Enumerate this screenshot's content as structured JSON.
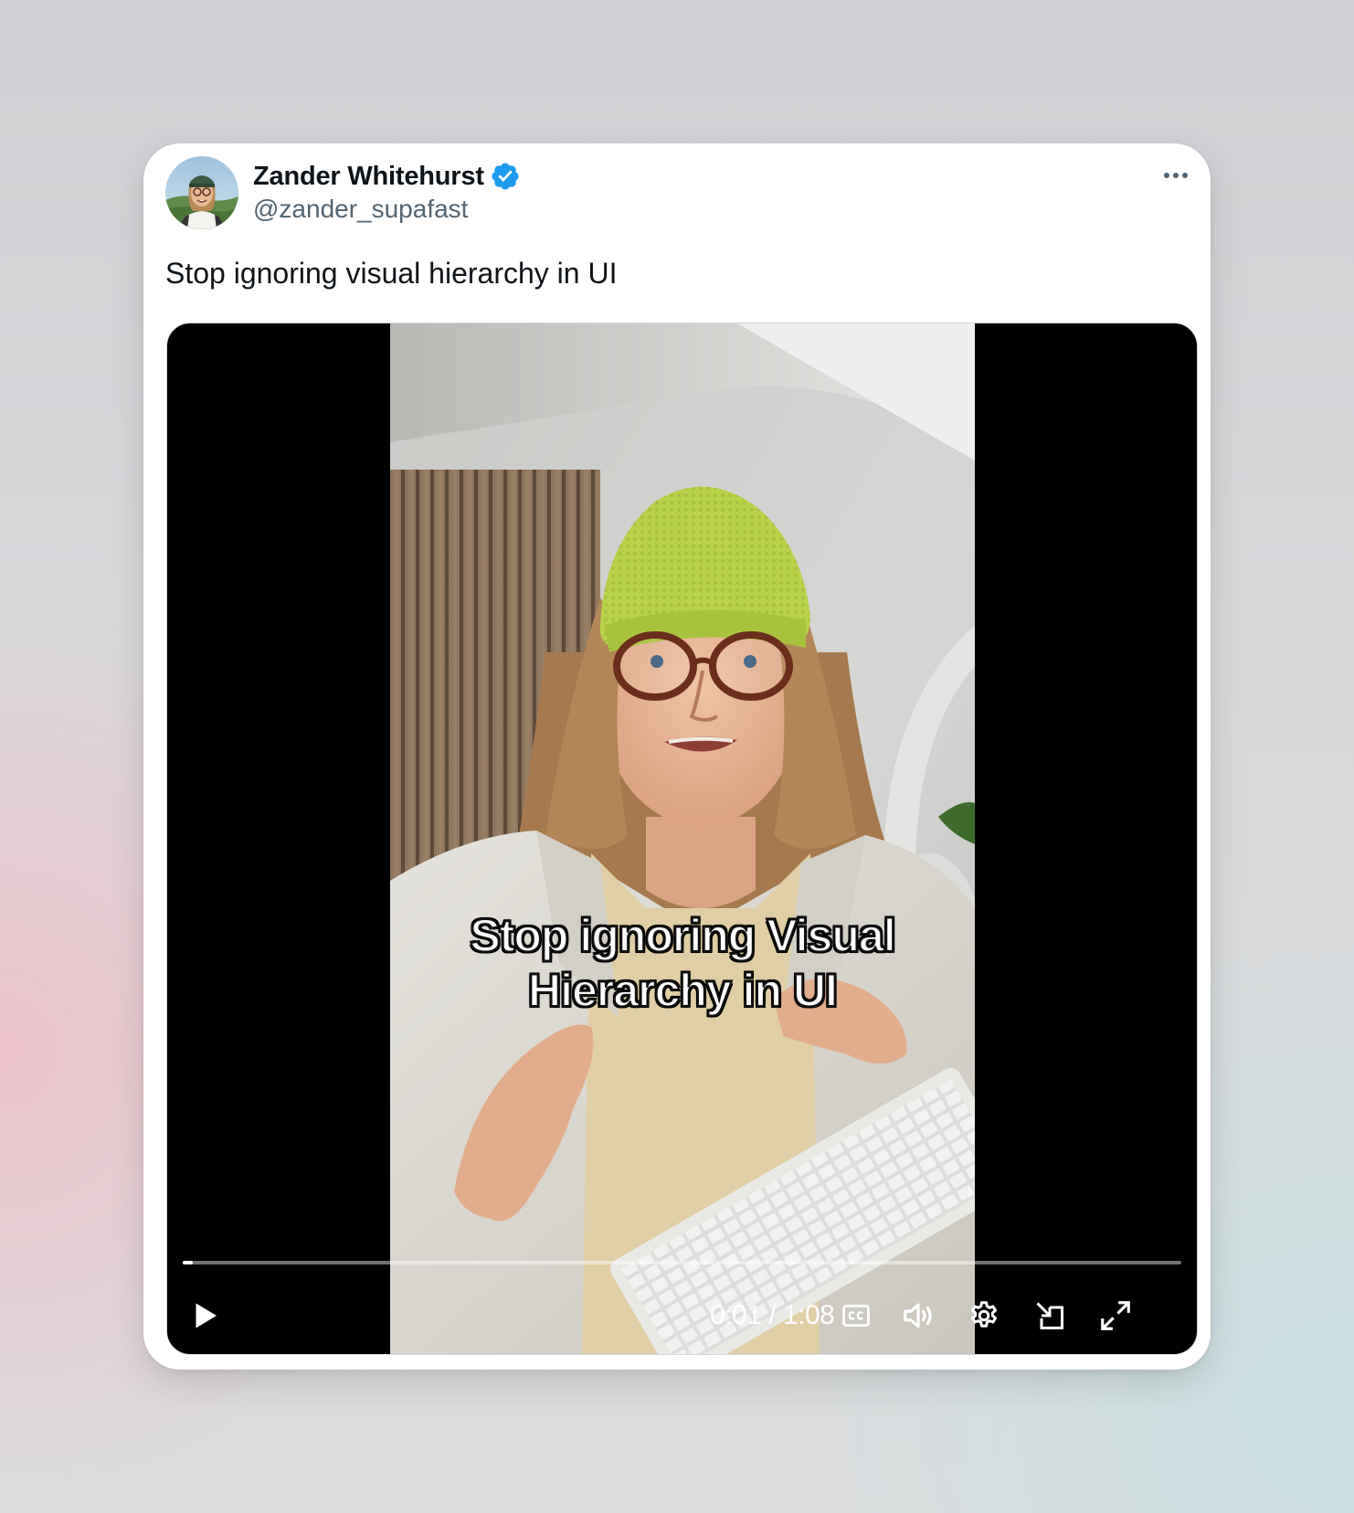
{
  "tweet": {
    "author_name": "Zander Whitehurst",
    "author_handle": "@zander_supafast",
    "text": "Stop ignoring visual hierarchy in UI",
    "verified": true,
    "verified_color": "#1d9bf0"
  },
  "video": {
    "caption_line1": "Stop ignoring Visual",
    "caption_line2": "Hierarchy in UI",
    "time_current": "0:01",
    "time_separator": "/",
    "time_total": "1:08",
    "progress_fraction": 0.01,
    "controls": [
      "play-icon",
      "closed-captions-icon",
      "volume-icon",
      "settings-icon",
      "pop-out-icon",
      "fullscreen-icon"
    ]
  },
  "colors": {
    "text_primary": "#0f1419",
    "text_secondary": "#536471",
    "beanie": "#b9d24a"
  }
}
